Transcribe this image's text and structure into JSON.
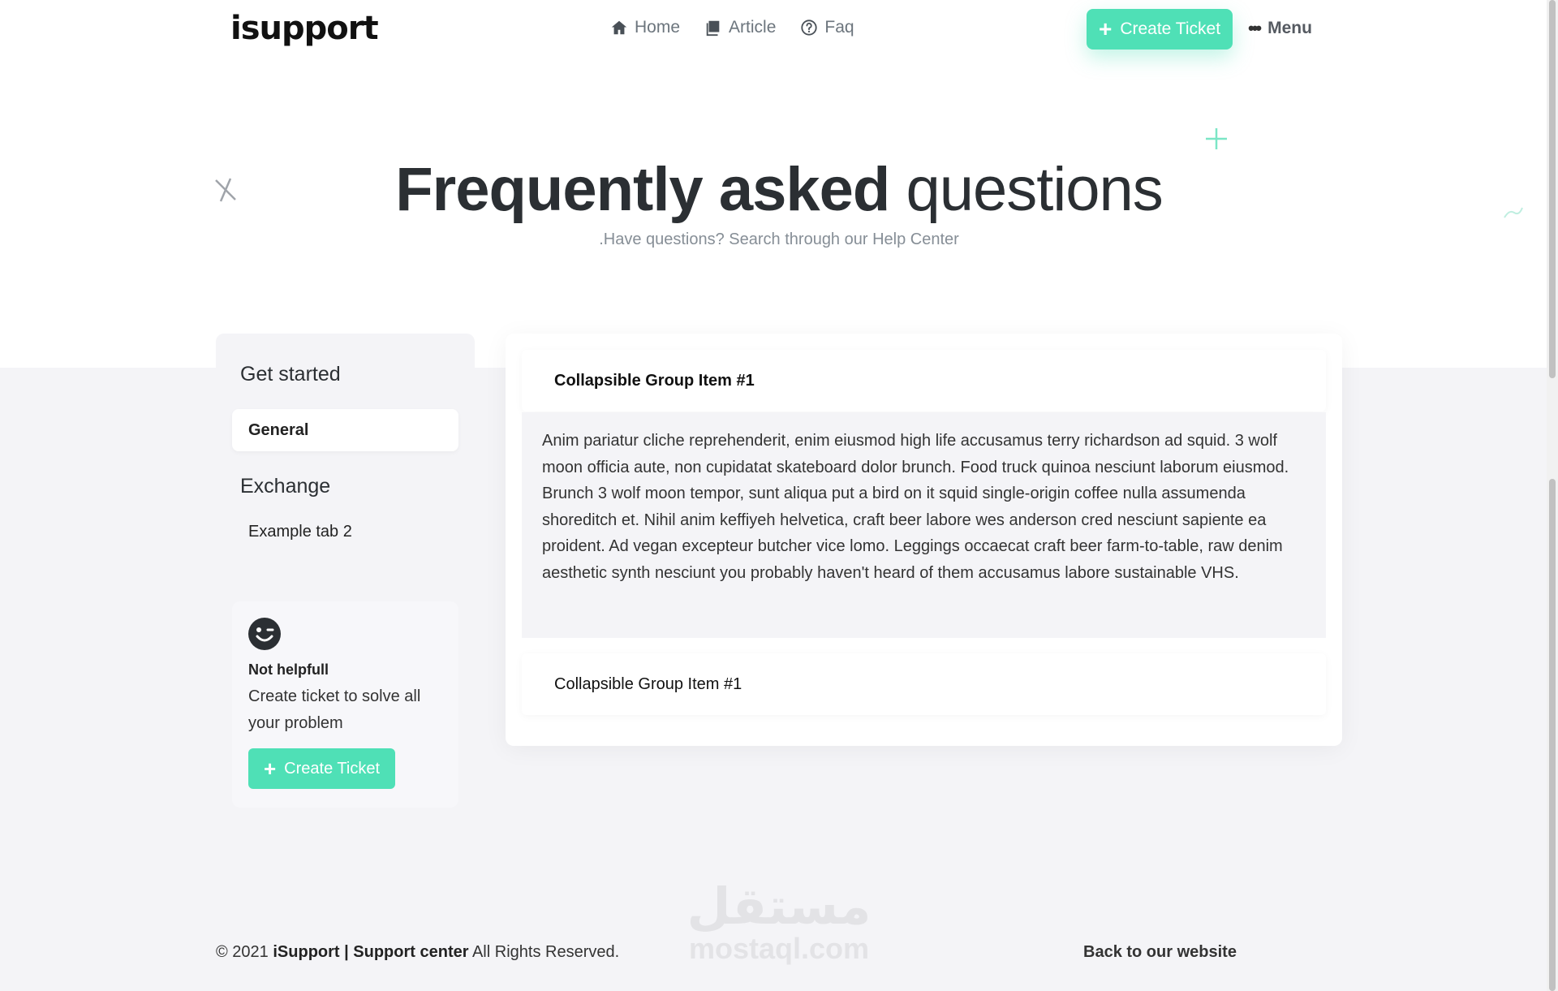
{
  "nav": {
    "logo": "isupport",
    "links": [
      {
        "label": "Home",
        "icon": "home-icon"
      },
      {
        "label": "Article",
        "icon": "article-icon"
      },
      {
        "label": "Faq",
        "icon": "question-circle-icon"
      }
    ],
    "create_ticket_label": "Create Ticket",
    "menu_label": "Menu"
  },
  "hero": {
    "title_bold": "Frequently asked",
    "title_light": "questions",
    "subtitle": ".Have questions? Search through our Help Center"
  },
  "sidebar": {
    "groups": [
      {
        "heading": "Get started",
        "items": [
          {
            "label": "General",
            "active": true
          }
        ]
      },
      {
        "heading": "Exchange",
        "items": [
          {
            "label": "Example tab 2",
            "active": false
          }
        ]
      }
    ],
    "help_card": {
      "title": "Not helpfull",
      "text": "Create ticket to solve all your problem",
      "button_label": "Create Ticket"
    }
  },
  "accordion": {
    "items": [
      {
        "title": "Collapsible Group Item #1",
        "open": true,
        "body": "Anim pariatur cliche reprehenderit, enim eiusmod high life accusamus terry richardson ad squid. 3 wolf moon officia aute, non cupidatat skateboard dolor brunch. Food truck quinoa nesciunt laborum eiusmod. Brunch 3 wolf moon tempor, sunt aliqua put a bird on it squid single-origin coffee nulla assumenda shoreditch et. Nihil anim keffiyeh helvetica, craft beer labore wes anderson cred nesciunt sapiente ea proident. Ad vegan excepteur butcher vice lomo. Leggings occaecat craft beer farm-to-table, raw denim aesthetic synth nesciunt you probably haven't heard of them accusamus labore sustainable VHS."
      },
      {
        "title": "Collapsible Group Item #1",
        "open": false
      }
    ]
  },
  "footer": {
    "copyright_prefix": "© 2021",
    "brand": "iSupport | Support center",
    "rights": "All Rights Reserved.",
    "back_link": "Back to our website"
  },
  "watermark": {
    "arabic": "مستقل",
    "latin": "mostaql.com"
  },
  "colors": {
    "accent": "#4fe0b6",
    "heading": "#2b2f33",
    "muted": "#868e96",
    "band": "#f4f4f7"
  }
}
